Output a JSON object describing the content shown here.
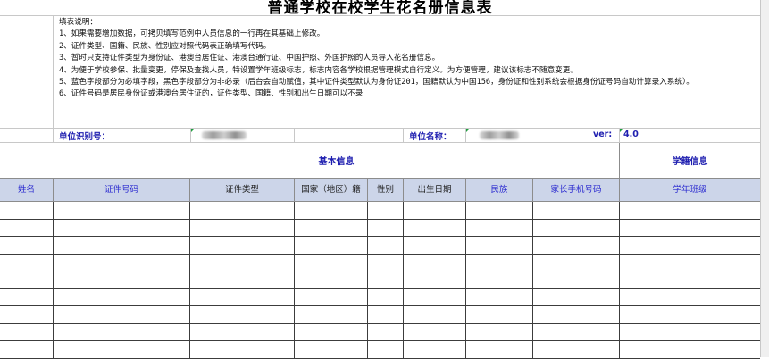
{
  "title": "普通学校在校学生花名册信息表",
  "notes": [
    "填表说明：",
    "1、如果需要增加数据，可拷贝填写范例中人员信息的一行再在其基础上修改。",
    "2、证件类型、国籍、民族、性别应对照代码表正确填写代码。",
    "3、暂时只支持证件类型为身份证、港澳台居住证、港澳台通行证、中国护照、外国护照的人员导入花名册信息。",
    "4、为便于学校参保、批量变更，停保及查找人员，特设置学年班级标志，标志内容各学校根据管理模式自行定义。为方便管理，建议该标志不随意变更。",
    "5、蓝色字段部分为必填字段，黑色字段部分为非必录（后台会自动赋值，其中证件类型默认为身份证201，国籍默认为中国156，身份证和性别系统会根据身份证号码自动计算录入系统）。",
    "6、证件号码是居民身份证或港澳台居住证的，证件类型、国籍、性别和出生日期可以不录"
  ],
  "unit_row": {
    "id_label": "单位识别号：",
    "name_label": "单位名称：",
    "ver_label": "ver:",
    "ver_value": "4.0"
  },
  "groups": {
    "basic": "基本信息",
    "school": "学籍信息"
  },
  "columns": [
    {
      "label": "姓名",
      "required": true
    },
    {
      "label": "证件号码",
      "required": true
    },
    {
      "label": "证件类型",
      "required": false
    },
    {
      "label": "国家（地区）籍",
      "required": false
    },
    {
      "label": "性别",
      "required": false
    },
    {
      "label": "出生日期",
      "required": false
    },
    {
      "label": "民族",
      "required": true
    },
    {
      "label": "家长手机号码",
      "required": true
    },
    {
      "label": "学年班级",
      "required": true
    }
  ],
  "colors": {
    "header_bg": "#ccd5e9",
    "required_text": "#2a2ad0",
    "label_text": "#1f1fb0",
    "marker": "#1e9e3e"
  }
}
